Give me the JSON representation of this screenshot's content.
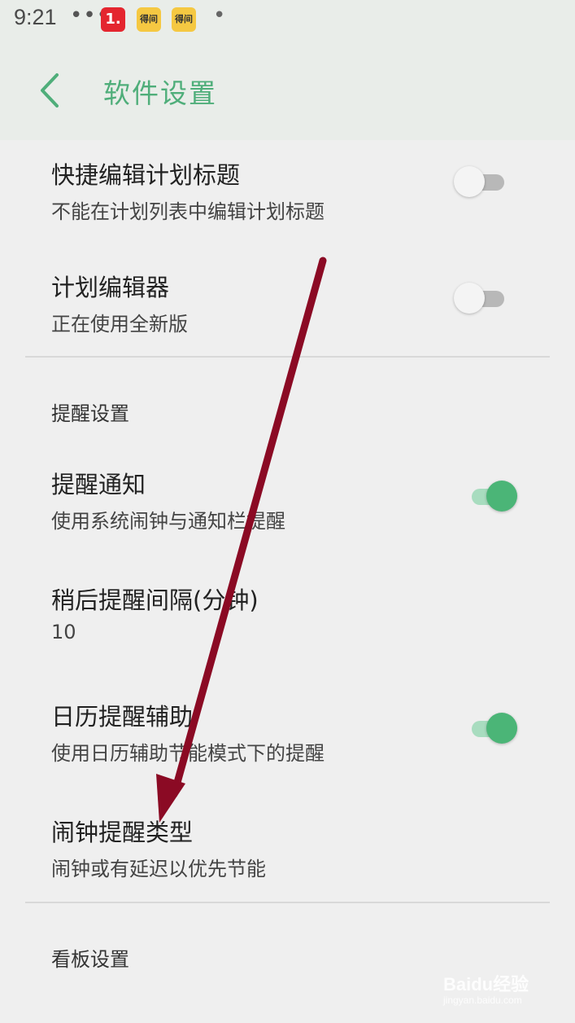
{
  "status_bar": {
    "time": "9:21",
    "dots": "•••",
    "icons": [
      {
        "name": "app-1-icon",
        "text": "1."
      },
      {
        "name": "dewen-icon",
        "text": "得间"
      },
      {
        "name": "dewen-icon-2",
        "text": "得间"
      }
    ],
    "bullet": "•"
  },
  "header": {
    "back_icon": "chevron-left-icon",
    "title": "软件设置",
    "accent_color": "#4fae7a"
  },
  "settings": {
    "quick_edit": {
      "title": "快捷编辑计划标题",
      "subtitle": "不能在计划列表中编辑计划标题",
      "enabled": false
    },
    "plan_editor": {
      "title": "计划编辑器",
      "subtitle": "正在使用全新版",
      "enabled": false
    },
    "reminder_section": "提醒设置",
    "reminder_notify": {
      "title": "提醒通知",
      "subtitle": "使用系统闹钟与通知栏提醒",
      "enabled": true
    },
    "snooze_interval": {
      "title": "稍后提醒间隔(分钟)",
      "value": "10"
    },
    "calendar_assist": {
      "title": "日历提醒辅助",
      "subtitle": "使用日历辅助节能模式下的提醒",
      "enabled": true
    },
    "alarm_type": {
      "title": "闹钟提醒类型",
      "subtitle": "闹钟或有延迟以优先节能"
    },
    "kanban_section": "看板设置"
  },
  "colors": {
    "switch_on": "#4bb577",
    "arrow": "#8b0a24"
  },
  "watermark": {
    "text": "Baidu经验",
    "url": "jingyan.baidu.com"
  }
}
